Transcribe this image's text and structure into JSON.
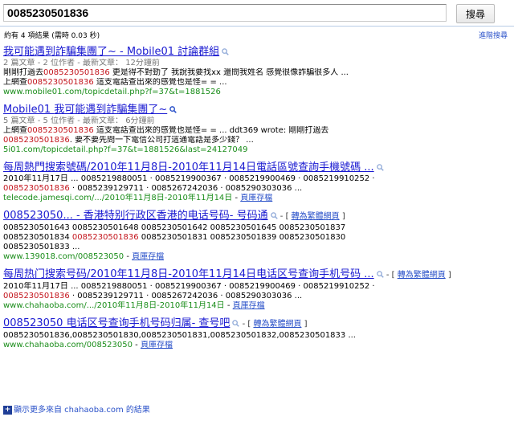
{
  "search": {
    "query": "0085230501836",
    "button_label": "搜尋",
    "stats": "約有 4 項結果 (需時 0.03 秒)",
    "advanced_label": "進階搜尋"
  },
  "results": [
    {
      "title": "我可能遇到詐騙集團了~ - Mobile01 討論群組",
      "meta": "2 篇文章 - 2 位作者 - 最新文章： 12分鐘前",
      "snippet1": [
        "剛剛打過去",
        "0085230501836",
        " 更是得不對勁了 我說我要找xx 還問我姓名 感覺很像詐騙很多人 ..."
      ],
      "snippet2": [
        "上網查",
        "0085230501836",
        " 這支電話查出來的感覺也是怪= = ..."
      ],
      "url": "www.mobile01.com/topicdetail.php?f=37&t=1881526"
    },
    {
      "title_prefix": "Mobile01 ",
      "title": "我可能遇到詐騙集團了~",
      "meta": "5 篇文章 - 5 位作者 - 最新文章： 6分鐘前",
      "snippet1": [
        "上網查",
        "0085230501836",
        " 這支電話查出來的感覺也是怪= = ... ddt369 wrote: 剛剛打過去"
      ],
      "snippet2": [
        "",
        "0085230501836",
        ". 要不要先問一下電信公司打這通電話是多少錢？ ..."
      ],
      "url": "5i01.com/topicdetail.php?f=37&t=1881526&last=24127049"
    },
    {
      "title": "每周熱門搜索號碼/2010年11月8日-2010年11月14日電話區號查詢手機號碼 ...",
      "line1": "2010年11月17日 ... 0085219880051 · 0085219900367 · 0085219900469 · 0085219910252 ·",
      "line2": [
        "",
        "0085230501836",
        " · 0085239129711 · 0085267242036 · 0085290303036 ..."
      ],
      "url": "telecode.jamesqi.com/.../2010年11月8日-2010年11月14日",
      "cache": "頁庫存檔"
    },
    {
      "title": "008523050... - 香港特别行政区香港的电话号码- 号码通",
      "translate": "轉為繁體網頁",
      "line1": "0085230501643 0085230501648 0085230501642 0085230501645 0085230501837",
      "line2": [
        "0085230501834 ",
        "0085230501836",
        " 0085230501831 0085230501839 0085230501830"
      ],
      "line3": "0085230501833 ...",
      "url": "www.139018.com/008523050",
      "cache": "頁庫存檔"
    },
    {
      "title": "每周热门搜索号码/2010年11月8日-2010年11月14日电话区号查询手机号码 ...",
      "translate": "轉為繁體網頁",
      "line1": "2010年11月17日 ... 0085219880051 · 0085219900367 · 0085219900469 · 0085219910252 ·",
      "line2": [
        "",
        "0085230501836",
        " · 0085239129711 · 0085267242036 · 0085290303036 ..."
      ],
      "url": "www.chahaoba.com/.../2010年11月8日-2010年11月14日",
      "cache": "頁庫存檔"
    },
    {
      "title": "008523050 电话区号查询手机号码归属- 查号吧",
      "translate": "轉為繁體網頁",
      "line1": "0085230501836,0085230501830,0085230501831,0085230501832,0085230501833 ...",
      "url": "www.chahaoba.com/008523050",
      "cache": "頁庫存檔"
    }
  ],
  "more_results": "顯示更多來自 chahaoba.com 的結果",
  "icons": {
    "magnifier": "magnifier-icon",
    "expand": "plus-icon"
  },
  "colors": {
    "link": "#1a1ad1",
    "highlight": "#c3141c",
    "url": "#1a8d1a",
    "meta": "#777777"
  }
}
